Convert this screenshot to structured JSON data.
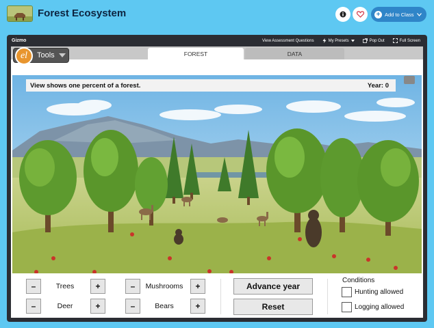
{
  "header": {
    "title": "Forest Ecosystem",
    "add_to_class_label": "Add to Class"
  },
  "gizmo_bar": {
    "brand": "Gizmo",
    "links": {
      "assessment": "View Assessment Questions",
      "presets": "My Presets",
      "pop_out": "Pop Out",
      "full_screen": "Full Screen"
    }
  },
  "toolbar": {
    "tools_label": "Tools",
    "logo_text": "el"
  },
  "tabs": [
    {
      "label": "FOREST",
      "active": true
    },
    {
      "label": "DATA",
      "active": false
    }
  ],
  "scene": {
    "caption": "View shows one percent of a forest.",
    "year_label": "Year: 0"
  },
  "controls": {
    "left_group": [
      {
        "label": "Trees"
      },
      {
        "label": "Deer"
      }
    ],
    "right_group": [
      {
        "label": "Mushrooms"
      },
      {
        "label": "Bears"
      }
    ],
    "minus_symbol": "–",
    "plus_symbol": "+",
    "advance_label": "Advance year",
    "reset_label": "Reset"
  },
  "conditions": {
    "title": "Conditions",
    "options": [
      {
        "label": "Hunting allowed",
        "checked": false
      },
      {
        "label": "Logging allowed",
        "checked": false
      }
    ]
  },
  "colors": {
    "page_bg": "#5ec8f2",
    "frame_bg": "#2b2d33",
    "class_button": "#2f85c8",
    "logo": "#e8952e"
  }
}
